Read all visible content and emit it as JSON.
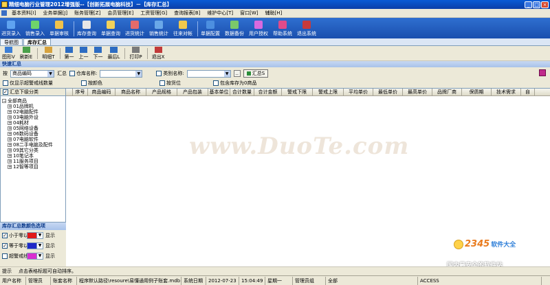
{
  "window": {
    "title": "精细电脑行业管理2012增强版--【创新拓展电脑科技】－【库存汇总】",
    "controls": [
      "_",
      "□",
      "×"
    ]
  },
  "menu": [
    "基本资料[I]",
    "业务单据[J]",
    "账务管理[Z]",
    "会员管理[E]",
    "工资管理[G]",
    "查询报表[B]",
    "维护中心[T]",
    "窗口[W]",
    "辅助[H]"
  ],
  "toolbar": [
    {
      "label": "进货录入",
      "color": "#5fa3f0"
    },
    {
      "label": "销售录入",
      "color": "#6fd46a"
    },
    {
      "label": "单据审核",
      "color": "#f0c24a"
    },
    {
      "label": "库存查询",
      "color": "#e6e6e6"
    },
    {
      "label": "单据查询",
      "color": "#f2d25a"
    },
    {
      "label": "进货统计",
      "color": "#e26b6b"
    },
    {
      "label": "销售统计",
      "color": "#6aa8e8"
    },
    {
      "label": "往来对帐",
      "color": "#f1c84c"
    },
    {
      "label": "单据配置",
      "color": "#4c8fe0"
    },
    {
      "label": "数据备份",
      "color": "#7bc96a"
    },
    {
      "label": "用户授权",
      "color": "#d96adf"
    },
    {
      "label": "帮助系统",
      "color": "#e04b8a"
    },
    {
      "label": "退出系统",
      "color": "#c83a3a"
    }
  ],
  "tabs": [
    "导航图",
    "库存汇总"
  ],
  "subtoolbar": [
    {
      "label": "图形V",
      "color": "#3d7fd6"
    },
    {
      "label": "刷新E",
      "color": "#4aa04a"
    },
    {
      "label": "明细T",
      "color": "#d6a23d"
    },
    {
      "label": "第一",
      "color": "#2d6cc2"
    },
    {
      "label": "上一",
      "color": "#2d6cc2"
    },
    {
      "label": "下一",
      "color": "#2d6cc2"
    },
    {
      "label": "最后L",
      "color": "#2d6cc2"
    },
    {
      "label": "打印P",
      "color": "#7a7a7a"
    },
    {
      "label": "退出X",
      "color": "#c23a3a"
    }
  ],
  "section_title": "快速汇总",
  "filter": {
    "by_label": "按",
    "by_value": "商品编码",
    "summary_label": "汇总",
    "warehouse_label": "仓库名称:",
    "category_label": "类别名称:",
    "ellipsis": "..",
    "summary_button": "汇总S",
    "only_over_alarm": "仅显示超警戒线数量",
    "by_color": "按颜色",
    "by_slot": "按货位",
    "include_zero": "包含库存为0商品"
  },
  "left_panel": {
    "header": "汇总下级分类",
    "root": "全部商品",
    "items": [
      "01品牌机",
      "02电脑配件",
      "03电脑外设",
      "04耗材",
      "05网络设备",
      "06数码设备",
      "07电脑软件",
      "08二手电脑及配件",
      "09其它分类",
      "10笔记本",
      "11服务项目",
      "12智等项目"
    ]
  },
  "grid": {
    "columns": [
      "序号",
      "商品编码",
      "商品名称",
      "产品规格",
      "产品包装",
      "基本单位",
      "合计数量",
      "合计金额",
      "警戒下限",
      "警戒上限",
      "平均单价",
      "最低单价",
      "最高单价",
      "品牌厂商",
      "保质期",
      "技术需求",
      "自"
    ]
  },
  "color_options": {
    "title": "库存汇总数颜色选项",
    "rows": [
      {
        "label": "小于零以",
        "swatch": "#e01919",
        "show": "显示",
        "checked": true
      },
      {
        "label": "等于零以",
        "swatch": "#1f29c7",
        "show": "显示",
        "checked": true
      },
      {
        "label": "超警戒线",
        "swatch": "#d92fd0",
        "show": "显示",
        "checked": false
      }
    ]
  },
  "statusbar": {
    "hint_label": "提示",
    "hint": "点击表格标题可自动排序。",
    "cells": [
      {
        "text": "用户名称"
      },
      {
        "text": "管理员"
      },
      {
        "text": "账套名称"
      },
      {
        "text": "程序默认路径\\resoure\\易懂通用例子账套.mdb"
      },
      {
        "text": "系统日期"
      },
      {
        "text": "2012-07-23"
      },
      {
        "text": "15:04:49"
      },
      {
        "text": "星期一"
      },
      {
        "text": "管理员组"
      },
      {
        "text": "全部"
      },
      {
        "text": "ACCESS"
      }
    ]
  },
  "watermark": "www.DuoTe.com",
  "overlay_logo": {
    "brand": "2345",
    "suffix": "软件大全",
    "slogan": "国内最安全的软件站"
  }
}
